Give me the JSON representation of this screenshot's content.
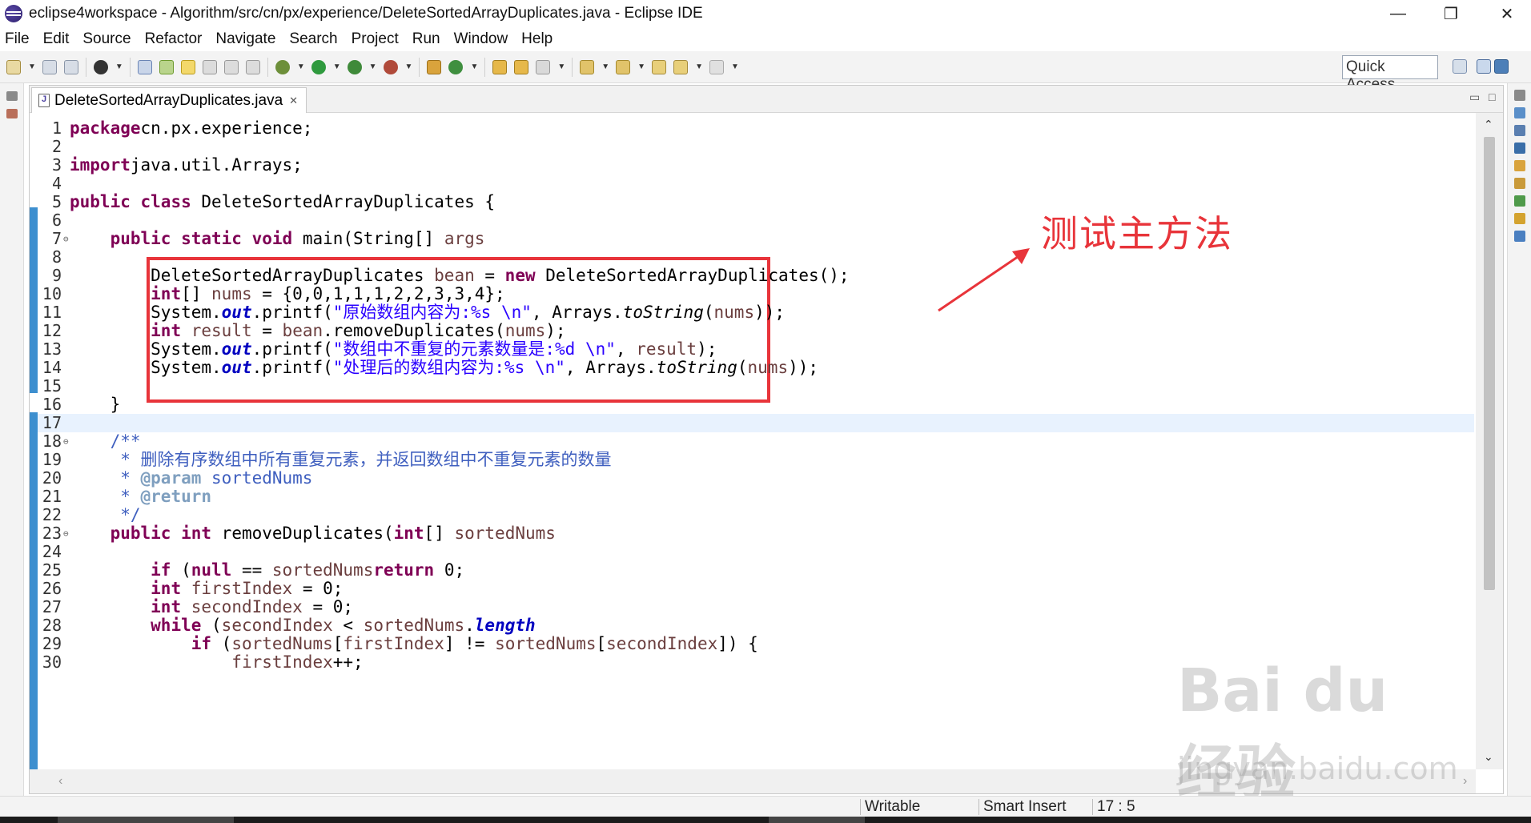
{
  "window": {
    "title": "eclipse4workspace - Algorithm/src/cn/px/experience/DeleteSortedArrayDuplicates.java - Eclipse IDE",
    "minimize": "—",
    "maximize": "❐",
    "close": "✕"
  },
  "menu": [
    "File",
    "Edit",
    "Source",
    "Refactor",
    "Navigate",
    "Search",
    "Project",
    "Run",
    "Window",
    "Help"
  ],
  "toolbar": {
    "quick_access": "Quick Access"
  },
  "editor": {
    "tab_label": "DeleteSortedArrayDuplicates.java",
    "tab_close": "✕",
    "current_line": 17
  },
  "annotation": {
    "text": "测试主方法",
    "color": "#e8343a"
  },
  "code": {
    "lines": [
      {
        "n": "1",
        "segments": [
          [
            "kw",
            "package"
          ],
          [
            "",
            "cn.px.experience;"
          ]
        ]
      },
      {
        "n": "2",
        "segments": []
      },
      {
        "n": "3",
        "segments": [
          [
            "kw",
            "import"
          ],
          [
            "",
            "java.util.Arrays;"
          ]
        ]
      },
      {
        "n": "4",
        "segments": []
      },
      {
        "n": "5",
        "segments": [
          [
            "kw",
            "public"
          ],
          [
            "",
            " "
          ],
          [
            "kw",
            "class"
          ],
          [
            "",
            " DeleteSortedArrayDuplicates {"
          ]
        ]
      },
      {
        "n": "6",
        "segments": []
      },
      {
        "n": "7",
        "fold": "⊖",
        "segments": [
          [
            "",
            "    "
          ],
          [
            "kw",
            "public"
          ],
          [
            "",
            " "
          ],
          [
            "kw",
            "static"
          ],
          [
            "",
            " "
          ],
          [
            "kw",
            "void"
          ],
          [
            "",
            " main(String[] "
          ],
          [
            "var",
            "args"
          ],
          [
            ") {"
          ]
        ]
      },
      {
        "n": "8",
        "segments": []
      },
      {
        "n": "9",
        "segments": [
          [
            "",
            "        DeleteSortedArrayDuplicates "
          ],
          [
            "var",
            "bean"
          ],
          [
            "",
            " = "
          ],
          [
            "kw",
            "new"
          ],
          [
            "",
            " DeleteSortedArrayDuplicates();"
          ]
        ]
      },
      {
        "n": "10",
        "segments": [
          [
            "",
            "        "
          ],
          [
            "kw",
            "int"
          ],
          [
            "",
            "[] "
          ],
          [
            "var",
            "nums"
          ],
          [
            "",
            " = {0,0,1,1,1,2,2,3,3,4};"
          ]
        ]
      },
      {
        "n": "11",
        "segments": [
          [
            "",
            "        System."
          ],
          [
            "fld",
            "out"
          ],
          [
            "",
            ".printf("
          ],
          [
            "str",
            "\"原始数组内容为:%s \\n\""
          ],
          [
            "",
            ", Arrays."
          ],
          [
            "sm",
            "toString"
          ],
          [
            "",
            "("
          ],
          [
            "var",
            "nums"
          ],
          [
            "",
            "));"
          ]
        ]
      },
      {
        "n": "12",
        "segments": [
          [
            "",
            "        "
          ],
          [
            "kw",
            "int"
          ],
          [
            "",
            " "
          ],
          [
            "var",
            "result"
          ],
          [
            "",
            " = "
          ],
          [
            "var",
            "bean"
          ],
          [
            "",
            ".removeDuplicates("
          ],
          [
            "var",
            "nums"
          ],
          [
            "",
            ");"
          ]
        ]
      },
      {
        "n": "13",
        "segments": [
          [
            "",
            "        System."
          ],
          [
            "fld",
            "out"
          ],
          [
            "",
            ".printf("
          ],
          [
            "str",
            "\"数组中不重复的元素数量是:%d \\n\""
          ],
          [
            "",
            ", "
          ],
          [
            "var",
            "result"
          ],
          [
            "",
            ");"
          ]
        ]
      },
      {
        "n": "14",
        "segments": [
          [
            "",
            "        System."
          ],
          [
            "fld",
            "out"
          ],
          [
            "",
            ".printf("
          ],
          [
            "str",
            "\"处理后的数组内容为:%s \\n\""
          ],
          [
            "",
            ", Arrays."
          ],
          [
            "sm",
            "toString"
          ],
          [
            "",
            "("
          ],
          [
            "var",
            "nums"
          ],
          [
            "",
            "));"
          ]
        ]
      },
      {
        "n": "15",
        "segments": []
      },
      {
        "n": "16",
        "segments": [
          [
            "",
            "    }"
          ]
        ]
      },
      {
        "n": "17",
        "segments": []
      },
      {
        "n": "18",
        "fold": "⊖",
        "segments": [
          [
            "",
            "    "
          ],
          [
            "cmt",
            "/**"
          ]
        ]
      },
      {
        "n": "19",
        "segments": [
          [
            "",
            "    "
          ],
          [
            "cmt",
            " * 删除有序数组中所有重复元素，并返回数组中不重复元素的数量"
          ]
        ]
      },
      {
        "n": "20",
        "segments": [
          [
            "",
            "     "
          ],
          [
            "cmt",
            "* "
          ],
          [
            "tag",
            "@param"
          ],
          [
            "cmt",
            " sortedNums"
          ]
        ]
      },
      {
        "n": "21",
        "segments": [
          [
            "",
            "     "
          ],
          [
            "cmt",
            "* "
          ],
          [
            "tag",
            "@return"
          ]
        ]
      },
      {
        "n": "22",
        "segments": [
          [
            "",
            "     "
          ],
          [
            "cmt",
            "*/"
          ]
        ]
      },
      {
        "n": "23",
        "fold": "⊖",
        "segments": [
          [
            "",
            "    "
          ],
          [
            "kw",
            "public"
          ],
          [
            "",
            " "
          ],
          [
            "kw",
            "int"
          ],
          [
            "",
            " removeDuplicates("
          ],
          [
            "kw",
            "int"
          ],
          [
            "",
            "[] "
          ],
          [
            "var",
            "sortedNums"
          ],
          [
            ") {"
          ]
        ]
      },
      {
        "n": "24",
        "segments": []
      },
      {
        "n": "25",
        "segments": [
          [
            "",
            "        "
          ],
          [
            "kw",
            "if"
          ],
          [
            "",
            " ("
          ],
          [
            "kw",
            "null"
          ],
          [
            "",
            " == "
          ],
          [
            "var",
            "sortedNums"
          ],
          [
            ") "
          ],
          [
            "kw",
            "return"
          ],
          [
            "",
            " 0;"
          ]
        ]
      },
      {
        "n": "26",
        "segments": [
          [
            "",
            "        "
          ],
          [
            "kw",
            "int"
          ],
          [
            "",
            " "
          ],
          [
            "var",
            "firstIndex"
          ],
          [
            "",
            " = 0;"
          ]
        ]
      },
      {
        "n": "27",
        "segments": [
          [
            "",
            "        "
          ],
          [
            "kw",
            "int"
          ],
          [
            "",
            " "
          ],
          [
            "var",
            "secondIndex"
          ],
          [
            "",
            " = 0;"
          ]
        ]
      },
      {
        "n": "28",
        "segments": [
          [
            "",
            "        "
          ],
          [
            "kw",
            "while"
          ],
          [
            "",
            " ("
          ],
          [
            "var",
            "secondIndex"
          ],
          [
            "",
            " < "
          ],
          [
            "var",
            "sortedNums"
          ],
          [
            "",
            "."
          ],
          [
            "fld",
            "length"
          ],
          [
            ") {"
          ]
        ]
      },
      {
        "n": "29",
        "segments": [
          [
            "",
            "            "
          ],
          [
            "kw",
            "if"
          ],
          [
            "",
            " ("
          ],
          [
            "var",
            "sortedNums"
          ],
          [
            "",
            "["
          ],
          [
            "var",
            "firstIndex"
          ],
          [
            "",
            "] != "
          ],
          [
            "var",
            "sortedNums"
          ],
          [
            "",
            "["
          ],
          [
            "var",
            "secondIndex"
          ],
          [
            "",
            "]) {"
          ]
        ]
      },
      {
        "n": "30",
        "segments": [
          [
            "",
            "                "
          ],
          [
            "var",
            "firstIndex"
          ],
          [
            "",
            "++;"
          ]
        ]
      }
    ]
  },
  "status": {
    "writable": "Writable",
    "insert_mode": "Smart Insert",
    "position": "17 : 5"
  },
  "watermark": {
    "logo": "Bai du 经验",
    "url": "jingyan.baidu.com"
  }
}
